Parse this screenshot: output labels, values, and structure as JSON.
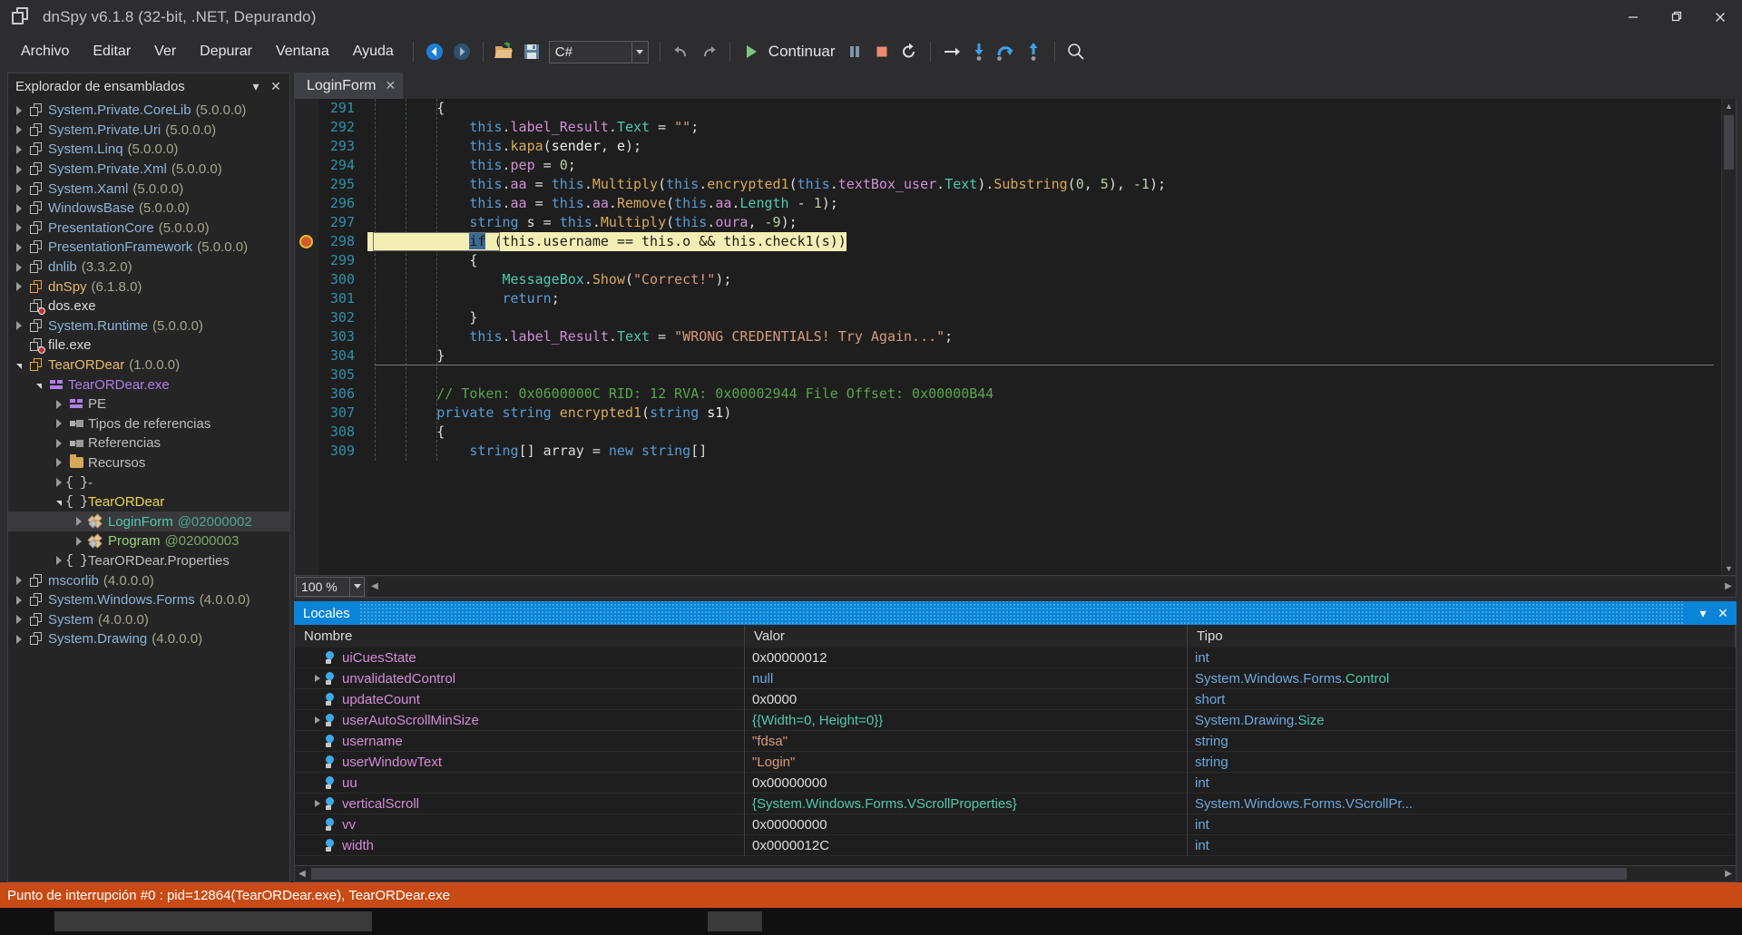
{
  "window": {
    "title": "dnSpy v6.1.8 (32-bit, .NET, Depurando)",
    "minimize": "–",
    "maximize": "❐",
    "close": "✕"
  },
  "menu": {
    "items": [
      "Archivo",
      "Editar",
      "Ver",
      "Depurar",
      "Ventana",
      "Ayuda"
    ]
  },
  "toolbar": {
    "back_icon": "back-arrow-icon",
    "forward_icon": "forward-arrow-icon",
    "open_icon": "open-folder-icon",
    "save_icon": "save-icon",
    "language": "C#",
    "undo_icon": "undo-icon",
    "redo_icon": "redo-icon",
    "continue_label": "Continuar",
    "break_icon": "pause-icon",
    "stop_icon": "stop-icon",
    "restart_icon": "restart-icon",
    "step_icon": "step-to-cursor-icon",
    "stepinto_icon": "step-into-icon",
    "stepover_icon": "step-over-icon",
    "stepout_icon": "step-out-icon",
    "search_icon": "search-icon"
  },
  "sidebar": {
    "title": "Explorador de ensamblados",
    "collapse_icon": "▾",
    "close_icon": "✕",
    "items": [
      {
        "label": "System.Private.CoreLib",
        "version": "(5.0.0.0)",
        "indent": 0,
        "icon": "assembly-icon",
        "state": "collapsed",
        "color": "asm"
      },
      {
        "label": "System.Private.Uri",
        "version": "(5.0.0.0)",
        "indent": 0,
        "icon": "assembly-icon",
        "state": "collapsed",
        "color": "asm"
      },
      {
        "label": "System.Linq",
        "version": "(5.0.0.0)",
        "indent": 0,
        "icon": "assembly-icon",
        "state": "collapsed",
        "color": "asm"
      },
      {
        "label": "System.Private.Xml",
        "version": "(5.0.0.0)",
        "indent": 0,
        "icon": "assembly-icon",
        "state": "collapsed",
        "color": "asm"
      },
      {
        "label": "System.Xaml",
        "version": "(5.0.0.0)",
        "indent": 0,
        "icon": "assembly-icon",
        "state": "collapsed",
        "color": "asm"
      },
      {
        "label": "WindowsBase",
        "version": "(5.0.0.0)",
        "indent": 0,
        "icon": "assembly-icon",
        "state": "collapsed",
        "color": "asm"
      },
      {
        "label": "PresentationCore",
        "version": "(5.0.0.0)",
        "indent": 0,
        "icon": "assembly-icon",
        "state": "collapsed",
        "color": "asm"
      },
      {
        "label": "PresentationFramework",
        "version": "(5.0.0.0)",
        "indent": 0,
        "icon": "assembly-icon",
        "state": "collapsed",
        "color": "asm"
      },
      {
        "label": "dnlib",
        "version": "(3.3.2.0)",
        "indent": 0,
        "icon": "assembly-icon",
        "state": "collapsed",
        "color": "asm"
      },
      {
        "label": "dnSpy",
        "version": "(6.1.8.0)",
        "indent": 0,
        "icon": "assembly-gold-icon",
        "state": "collapsed",
        "color": "orange"
      },
      {
        "label": "dos.exe",
        "version": "",
        "indent": 0,
        "icon": "assembly-error-icon",
        "state": "leaf",
        "color": "white"
      },
      {
        "label": "System.Runtime",
        "version": "(5.0.0.0)",
        "indent": 0,
        "icon": "assembly-icon",
        "state": "collapsed",
        "color": "asm"
      },
      {
        "label": "file.exe",
        "version": "",
        "indent": 0,
        "icon": "assembly-error-icon",
        "state": "leaf",
        "color": "white"
      },
      {
        "label": "TearORDear",
        "version": "(1.0.0.0)",
        "indent": 0,
        "icon": "assembly-gold-icon",
        "state": "expanded",
        "color": "orange"
      },
      {
        "label": "TearORDear.exe",
        "version": "",
        "indent": 1,
        "icon": "module-icon",
        "state": "expanded",
        "color": "purple"
      },
      {
        "label": "PE",
        "version": "",
        "indent": 2,
        "icon": "module-icon",
        "state": "collapsed",
        "color": "grey"
      },
      {
        "label": "Tipos de referencias",
        "version": "",
        "indent": 2,
        "icon": "reference-icon",
        "state": "collapsed",
        "color": "grey"
      },
      {
        "label": "Referencias",
        "version": "",
        "indent": 2,
        "icon": "reference-icon",
        "state": "collapsed",
        "color": "grey"
      },
      {
        "label": "Recursos",
        "version": "",
        "indent": 2,
        "icon": "folder-icon",
        "state": "collapsed",
        "color": "grey"
      },
      {
        "label": "-",
        "version": "",
        "indent": 2,
        "icon": "namespace-icon",
        "state": "collapsed",
        "color": "grey"
      },
      {
        "label": "TearORDear",
        "version": "",
        "indent": 2,
        "icon": "namespace-icon",
        "state": "expanded",
        "color": "yellow"
      },
      {
        "label": "LoginForm",
        "version": "@02000002",
        "indent": 3,
        "icon": "class-icon",
        "state": "collapsed",
        "color": "teal",
        "selected": true
      },
      {
        "label": "Program",
        "version": "@02000003",
        "indent": 3,
        "icon": "class-icon",
        "state": "collapsed",
        "color": "green"
      },
      {
        "label": "TearORDear.Properties",
        "version": "",
        "indent": 2,
        "icon": "namespace-icon",
        "state": "collapsed",
        "color": "grey"
      },
      {
        "label": "mscorlib",
        "version": "(4.0.0.0)",
        "indent": 0,
        "icon": "assembly-icon",
        "state": "collapsed",
        "color": "asm"
      },
      {
        "label": "System.Windows.Forms",
        "version": "(4.0.0.0)",
        "indent": 0,
        "icon": "assembly-icon",
        "state": "collapsed",
        "color": "asm"
      },
      {
        "label": "System",
        "version": "(4.0.0.0)",
        "indent": 0,
        "icon": "assembly-icon",
        "state": "collapsed",
        "color": "asm"
      },
      {
        "label": "System.Drawing",
        "version": "(4.0.0.0)",
        "indent": 0,
        "icon": "assembly-icon",
        "state": "collapsed",
        "color": "asm"
      }
    ]
  },
  "editor": {
    "tab_label": "LoginForm",
    "tab_close": "✕",
    "zoom": "100 %",
    "first_line": 291,
    "current_line": 298,
    "lines": [
      {
        "n": 291,
        "tokens": [
          {
            "t": "        {",
            "c": "plain"
          }
        ]
      },
      {
        "n": 292,
        "tokens": [
          {
            "t": "            ",
            "c": "plain"
          },
          {
            "t": "this",
            "c": "kw"
          },
          {
            "t": ".",
            "c": "plain"
          },
          {
            "t": "label_Result",
            "c": "field"
          },
          {
            "t": ".",
            "c": "plain"
          },
          {
            "t": "Text",
            "c": "prop"
          },
          {
            "t": " = ",
            "c": "plain"
          },
          {
            "t": "\"\"",
            "c": "str"
          },
          {
            "t": ";",
            "c": "plain"
          }
        ]
      },
      {
        "n": 293,
        "tokens": [
          {
            "t": "            ",
            "c": "plain"
          },
          {
            "t": "this",
            "c": "kw"
          },
          {
            "t": ".",
            "c": "plain"
          },
          {
            "t": "kapa",
            "c": "meth"
          },
          {
            "t": "(",
            "c": "plain"
          },
          {
            "t": "sender",
            "c": "param"
          },
          {
            "t": ", ",
            "c": "plain"
          },
          {
            "t": "e",
            "c": "param"
          },
          {
            "t": ");",
            "c": "plain"
          }
        ]
      },
      {
        "n": 294,
        "tokens": [
          {
            "t": "            ",
            "c": "plain"
          },
          {
            "t": "this",
            "c": "kw"
          },
          {
            "t": ".",
            "c": "plain"
          },
          {
            "t": "pep",
            "c": "field"
          },
          {
            "t": " = ",
            "c": "plain"
          },
          {
            "t": "0",
            "c": "num"
          },
          {
            "t": ";",
            "c": "plain"
          }
        ]
      },
      {
        "n": 295,
        "tokens": [
          {
            "t": "            ",
            "c": "plain"
          },
          {
            "t": "this",
            "c": "kw"
          },
          {
            "t": ".",
            "c": "plain"
          },
          {
            "t": "aa",
            "c": "field"
          },
          {
            "t": " = ",
            "c": "plain"
          },
          {
            "t": "this",
            "c": "kw"
          },
          {
            "t": ".",
            "c": "plain"
          },
          {
            "t": "Multiply",
            "c": "meth"
          },
          {
            "t": "(",
            "c": "plain"
          },
          {
            "t": "this",
            "c": "kw"
          },
          {
            "t": ".",
            "c": "plain"
          },
          {
            "t": "encrypted1",
            "c": "meth"
          },
          {
            "t": "(",
            "c": "plain"
          },
          {
            "t": "this",
            "c": "kw"
          },
          {
            "t": ".",
            "c": "plain"
          },
          {
            "t": "textBox_user",
            "c": "field"
          },
          {
            "t": ".",
            "c": "plain"
          },
          {
            "t": "Text",
            "c": "prop"
          },
          {
            "t": ").",
            "c": "plain"
          },
          {
            "t": "Substring",
            "c": "meth"
          },
          {
            "t": "(",
            "c": "plain"
          },
          {
            "t": "0",
            "c": "num"
          },
          {
            "t": ", ",
            "c": "plain"
          },
          {
            "t": "5",
            "c": "num"
          },
          {
            "t": "), ",
            "c": "plain"
          },
          {
            "t": "-1",
            "c": "num"
          },
          {
            "t": ");",
            "c": "plain"
          }
        ]
      },
      {
        "n": 296,
        "tokens": [
          {
            "t": "            ",
            "c": "plain"
          },
          {
            "t": "this",
            "c": "kw"
          },
          {
            "t": ".",
            "c": "plain"
          },
          {
            "t": "aa",
            "c": "field"
          },
          {
            "t": " = ",
            "c": "plain"
          },
          {
            "t": "this",
            "c": "kw"
          },
          {
            "t": ".",
            "c": "plain"
          },
          {
            "t": "aa",
            "c": "field"
          },
          {
            "t": ".",
            "c": "plain"
          },
          {
            "t": "Remove",
            "c": "meth"
          },
          {
            "t": "(",
            "c": "plain"
          },
          {
            "t": "this",
            "c": "kw"
          },
          {
            "t": ".",
            "c": "plain"
          },
          {
            "t": "aa",
            "c": "field"
          },
          {
            "t": ".",
            "c": "plain"
          },
          {
            "t": "Length",
            "c": "prop"
          },
          {
            "t": " - ",
            "c": "plain"
          },
          {
            "t": "1",
            "c": "num"
          },
          {
            "t": ");",
            "c": "plain"
          }
        ]
      },
      {
        "n": 297,
        "tokens": [
          {
            "t": "            ",
            "c": "plain"
          },
          {
            "t": "string",
            "c": "kw"
          },
          {
            "t": " s = ",
            "c": "plain"
          },
          {
            "t": "this",
            "c": "kw"
          },
          {
            "t": ".",
            "c": "plain"
          },
          {
            "t": "Multiply",
            "c": "meth"
          },
          {
            "t": "(",
            "c": "plain"
          },
          {
            "t": "this",
            "c": "kw"
          },
          {
            "t": ".",
            "c": "plain"
          },
          {
            "t": "oura",
            "c": "field"
          },
          {
            "t": ", ",
            "c": "plain"
          },
          {
            "t": "-9",
            "c": "num"
          },
          {
            "t": ");",
            "c": "plain"
          }
        ]
      },
      {
        "n": 298,
        "current": true,
        "pre": "            ",
        "sel": "if",
        "rest": " (this.username == this.o && this.check1(s))"
      },
      {
        "n": 299,
        "tokens": [
          {
            "t": "            {",
            "c": "plain"
          }
        ]
      },
      {
        "n": 300,
        "tokens": [
          {
            "t": "                ",
            "c": "plain"
          },
          {
            "t": "MessageBox",
            "c": "type"
          },
          {
            "t": ".",
            "c": "plain"
          },
          {
            "t": "Show",
            "c": "meth"
          },
          {
            "t": "(",
            "c": "plain"
          },
          {
            "t": "\"Correct!\"",
            "c": "str"
          },
          {
            "t": ");",
            "c": "plain"
          }
        ]
      },
      {
        "n": 301,
        "tokens": [
          {
            "t": "                ",
            "c": "plain"
          },
          {
            "t": "return",
            "c": "kw"
          },
          {
            "t": ";",
            "c": "plain"
          }
        ]
      },
      {
        "n": 302,
        "tokens": [
          {
            "t": "            }",
            "c": "plain"
          }
        ]
      },
      {
        "n": 303,
        "tokens": [
          {
            "t": "            ",
            "c": "plain"
          },
          {
            "t": "this",
            "c": "kw"
          },
          {
            "t": ".",
            "c": "plain"
          },
          {
            "t": "label_Result",
            "c": "field"
          },
          {
            "t": ".",
            "c": "plain"
          },
          {
            "t": "Text",
            "c": "prop"
          },
          {
            "t": " = ",
            "c": "plain"
          },
          {
            "t": "\"WRONG CREDENTIALS! Try Again...\"",
            "c": "str"
          },
          {
            "t": ";",
            "c": "plain"
          }
        ]
      },
      {
        "n": 304,
        "tokens": [
          {
            "t": "        }",
            "c": "plain"
          }
        ]
      },
      {
        "n": 305,
        "tokens": [
          {
            "t": "",
            "c": "plain"
          }
        ]
      },
      {
        "n": 306,
        "tokens": [
          {
            "t": "        ",
            "c": "plain"
          },
          {
            "t": "// Token: 0x0600000C RID: 12 RVA: 0x00002944 File Offset: 0x00000B44",
            "c": "cmt"
          }
        ]
      },
      {
        "n": 307,
        "tokens": [
          {
            "t": "        ",
            "c": "plain"
          },
          {
            "t": "private",
            "c": "kw"
          },
          {
            "t": " ",
            "c": "plain"
          },
          {
            "t": "string",
            "c": "kw"
          },
          {
            "t": " ",
            "c": "plain"
          },
          {
            "t": "encrypted1",
            "c": "meth"
          },
          {
            "t": "(",
            "c": "plain"
          },
          {
            "t": "string",
            "c": "kw"
          },
          {
            "t": " ",
            "c": "plain"
          },
          {
            "t": "s1",
            "c": "param"
          },
          {
            "t": ")",
            "c": "plain"
          }
        ]
      },
      {
        "n": 308,
        "tokens": [
          {
            "t": "        {",
            "c": "plain"
          }
        ]
      },
      {
        "n": 309,
        "tokens": [
          {
            "t": "            ",
            "c": "plain"
          },
          {
            "t": "string",
            "c": "kw"
          },
          {
            "t": "[] array = ",
            "c": "plain"
          },
          {
            "t": "new",
            "c": "kw"
          },
          {
            "t": " ",
            "c": "plain"
          },
          {
            "t": "string",
            "c": "kw"
          },
          {
            "t": "[]",
            "c": "plain"
          }
        ]
      }
    ]
  },
  "locals": {
    "title": "Locales",
    "collapse_icon": "▾",
    "close_icon": "✕",
    "columns": [
      "Nombre",
      "Valor",
      "Tipo"
    ],
    "rows": [
      {
        "name": "uiCuesState",
        "value": "0x00000012",
        "type": "int",
        "expandable": false,
        "value_color": "plain",
        "type_color": "kw"
      },
      {
        "name": "unvalidatedControl",
        "value": "null",
        "type": "System.Windows.Forms.Control",
        "expandable": true,
        "value_color": "blue",
        "type_color": "ns-type"
      },
      {
        "name": "updateCount",
        "value": "0x0000",
        "type": "short",
        "expandable": false,
        "value_color": "plain",
        "type_color": "kw"
      },
      {
        "name": "userAutoScrollMinSize",
        "value": "{{Width=0, Height=0}}",
        "type": "System.Drawing.Size",
        "expandable": true,
        "value_color": "teal",
        "type_color": "ns-type"
      },
      {
        "name": "username",
        "value": "\"fdsa\"",
        "type": "string",
        "expandable": false,
        "value_color": "str",
        "type_color": "kw"
      },
      {
        "name": "userWindowText",
        "value": "\"Login\"",
        "type": "string",
        "expandable": false,
        "value_color": "str",
        "type_color": "kw"
      },
      {
        "name": "uu",
        "value": "0x00000000",
        "type": "int",
        "expandable": false,
        "value_color": "plain",
        "type_color": "kw"
      },
      {
        "name": "verticalScroll",
        "value": "{System.Windows.Forms.VScrollProperties}",
        "type": "System.Windows.Forms.VScrollPr...",
        "expandable": true,
        "value_color": "teal",
        "type_color": "ns-type"
      },
      {
        "name": "vv",
        "value": "0x00000000",
        "type": "int",
        "expandable": false,
        "value_color": "plain",
        "type_color": "kw"
      },
      {
        "name": "width",
        "value": "0x0000012C",
        "type": "int",
        "expandable": false,
        "value_color": "plain",
        "type_color": "kw"
      }
    ]
  },
  "statusbar": {
    "text": "Punto de interrupción #0 : pid=12864(TearORDear.exe), TearORDear.exe"
  }
}
